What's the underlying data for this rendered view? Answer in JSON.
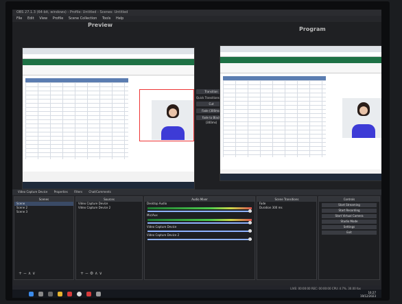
{
  "window": {
    "title": "OBS 27.1.3 (64-bit, windows) - Profile: Untitled - Scenes: Untitled"
  },
  "menu": {
    "items": [
      "File",
      "Edit",
      "View",
      "Profile",
      "Scene Collection",
      "Tools",
      "Help"
    ]
  },
  "preview": {
    "label": "Preview"
  },
  "program": {
    "label": "Program"
  },
  "transitions": {
    "transition_button": "Transition",
    "quick_label": "Quick Transitions",
    "items": [
      "Cut",
      "Fade (300ms)",
      "Fade to Black (300ms)"
    ]
  },
  "docks": {
    "tabs": [
      "Video Capture Device",
      "Properties",
      "Filters",
      "Chat/Comments"
    ],
    "scenes": {
      "title": "Scenes",
      "items": [
        "Scene",
        "Scene 2",
        "Scene 3"
      ]
    },
    "sources": {
      "title": "Sources",
      "items": [
        "Video Capture Device",
        "Video Capture Device 2"
      ]
    },
    "mixer": {
      "title": "Audio Mixer",
      "channels": [
        {
          "name": "Desktop Audio",
          "db": "0.0 dB"
        },
        {
          "name": "Mic/Aux",
          "db": "0.0 dB"
        },
        {
          "name": "Video Capture Device",
          "db": "0.0 dB"
        },
        {
          "name": "Video Capture Device 2",
          "db": "0.0 dB"
        }
      ]
    },
    "scene_transitions": {
      "title": "Scene Transitions",
      "type": "Fade",
      "duration_label": "Duration",
      "duration": "300 ms"
    },
    "controls": {
      "title": "Controls",
      "buttons": [
        "Start Streaming",
        "Start Recording",
        "Start Virtual Camera",
        "Studio Mode",
        "Settings",
        "Exit"
      ]
    }
  },
  "status": {
    "text": "LIVE: 00:00:00  REC: 00:00:00  CPU: 4.7%, 30.00 fps"
  },
  "clock": {
    "time": "16:27",
    "date": "19/12/2023"
  }
}
